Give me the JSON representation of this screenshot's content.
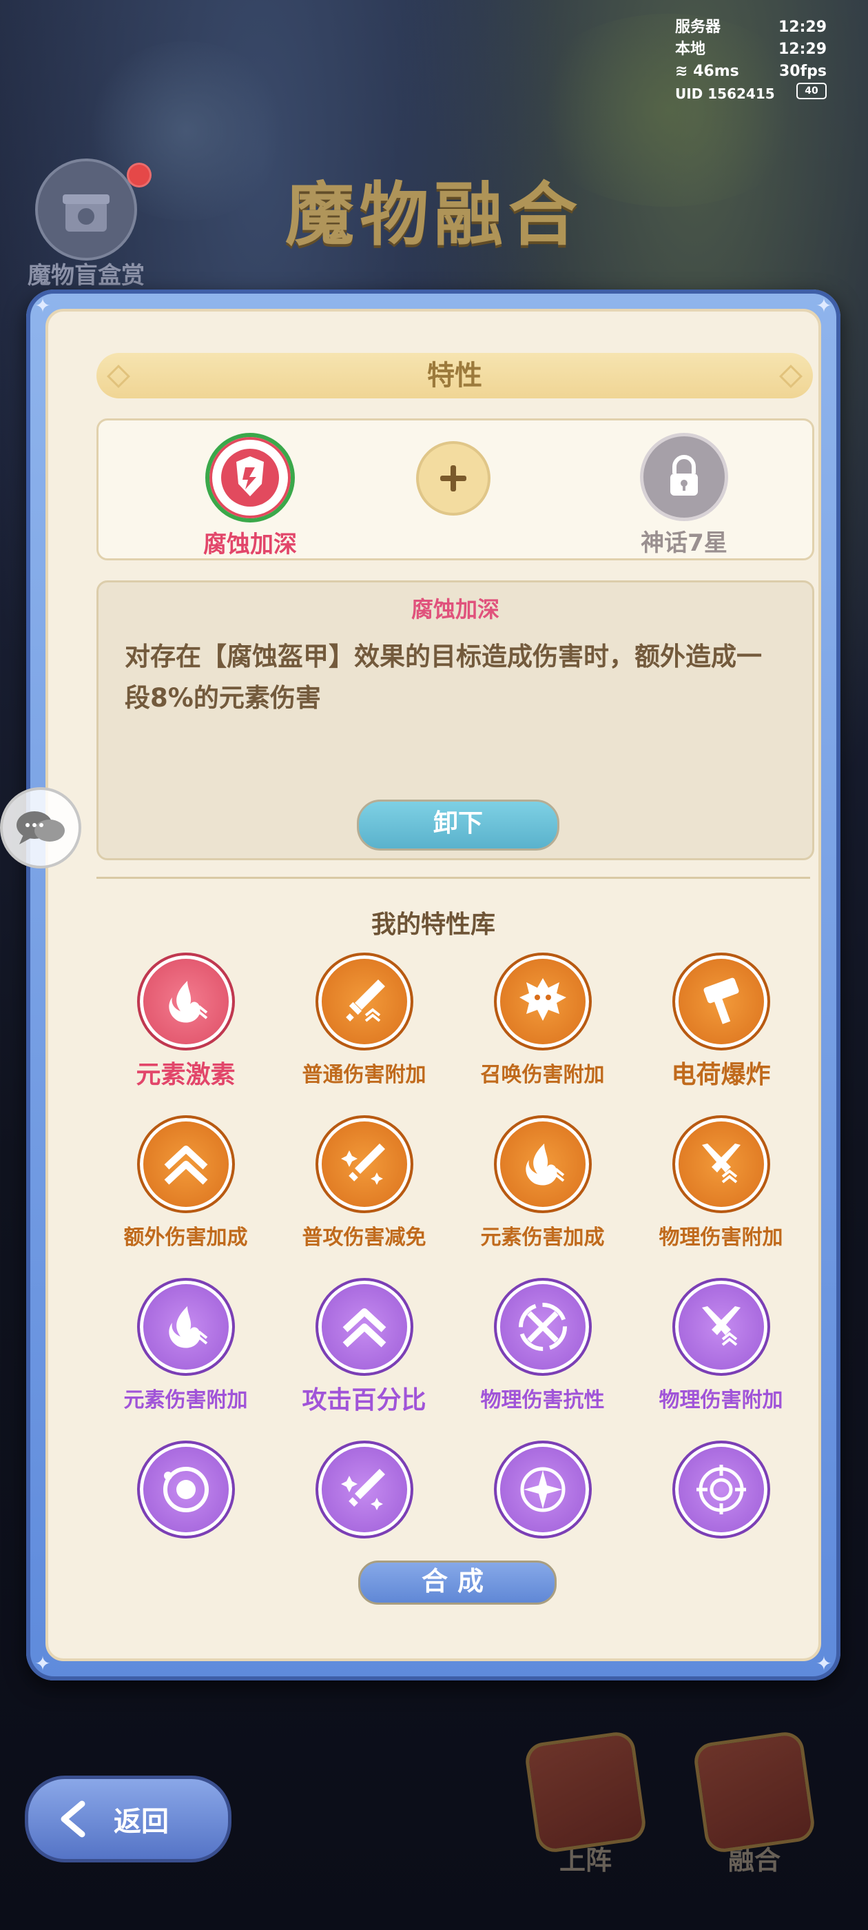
{
  "status": {
    "server_label": "服务器",
    "server_time": "12:29",
    "local_label": "本地",
    "local_time": "12:29",
    "ping": "46ms",
    "fps": "30fps",
    "uid": "UID 1562415",
    "battery": "40"
  },
  "blind_box": {
    "label": "魔物盲盒赏"
  },
  "page_title": "魔物融合",
  "traits_header": "特性",
  "slots": [
    {
      "name": "腐蚀加深",
      "icon": "corrosion-shield-icon",
      "color": "#e2466a"
    },
    {
      "name": "",
      "icon": "plus-icon"
    },
    {
      "name": "神话7星",
      "icon": "lock-icon",
      "color": "#9a9090"
    }
  ],
  "selected_trait": {
    "title": "腐蚀加深",
    "description": "对存在【腐蚀盔甲】效果的目标造成伤害时，额外造成一段8%的元素伤害",
    "unload_label": "卸下"
  },
  "library_title": "我的特性库",
  "traits": [
    {
      "name": "元素激素",
      "color": "pink",
      "icon": "element-flame-icon",
      "big": true
    },
    {
      "name": "普通伤害附加",
      "color": "orange",
      "icon": "sword-icon"
    },
    {
      "name": "召唤伤害附加",
      "color": "orange",
      "icon": "spiky-beast-icon"
    },
    {
      "name": "电荷爆炸",
      "color": "orange",
      "icon": "hammer-icon",
      "big": true
    },
    {
      "name": "额外伤害加成",
      "color": "orange",
      "icon": "chevron-up-icon"
    },
    {
      "name": "普攻伤害减免",
      "color": "orange",
      "icon": "sword-sparkle-icon"
    },
    {
      "name": "元素伤害加成",
      "color": "orange",
      "icon": "element-flame-icon"
    },
    {
      "name": "物理伤害附加",
      "color": "orange",
      "icon": "crossed-swords-icon"
    },
    {
      "name": "元素伤害附加",
      "color": "purple",
      "icon": "element-flame-icon"
    },
    {
      "name": "攻击百分比",
      "color": "purple",
      "icon": "chevron-up-icon",
      "big": true
    },
    {
      "name": "物理伤害抗性",
      "color": "purple",
      "icon": "sword-ring-icon"
    },
    {
      "name": "物理伤害附加",
      "color": "purple",
      "icon": "crossed-swords-icon"
    },
    {
      "name": "",
      "color": "purple",
      "icon": "orbit-icon"
    },
    {
      "name": "",
      "color": "purple",
      "icon": "sword-sparkle-icon"
    },
    {
      "name": "",
      "color": "purple",
      "icon": "compass-star-icon"
    },
    {
      "name": "",
      "color": "purple",
      "icon": "target-icon"
    }
  ],
  "compose_label": "合成",
  "back_label": "返回",
  "bottom_tabs": [
    {
      "label": "上阵",
      "icon": "deploy-icon"
    },
    {
      "label": "融合",
      "icon": "fusion-icon"
    }
  ]
}
